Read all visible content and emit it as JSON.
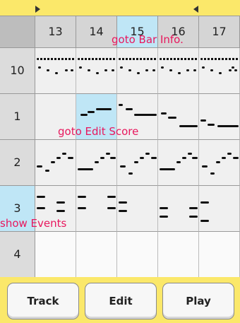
{
  "bar_numbers": [
    "13",
    "14",
    "15",
    "16",
    "17"
  ],
  "track_numbers": [
    "10",
    "1",
    "2",
    "3",
    "4"
  ],
  "hints": {
    "bar_info": "goto Bar Info.",
    "edit_score": "goto Edit Score",
    "show_events": "show Events"
  },
  "buttons": {
    "track": "Track",
    "edit": "Edit",
    "play": "Play"
  },
  "colors": {
    "background": "#fbe86a",
    "selected": "#bfe6f6",
    "hint": "#e8175d"
  }
}
